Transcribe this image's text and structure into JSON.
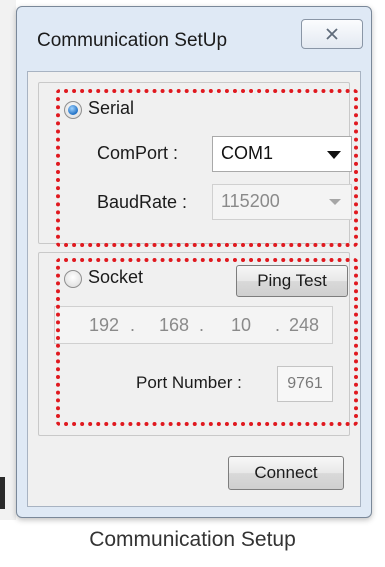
{
  "window": {
    "title": "Communication SetUp",
    "close_glyph": "✕"
  },
  "serial": {
    "radio_label": "Serial",
    "radio_checked": true,
    "comport_label": "ComPort :",
    "comport_value": "COM1",
    "baudrate_label": "BaudRate :",
    "baudrate_value": "115200",
    "baudrate_enabled": false
  },
  "socket": {
    "radio_label": "Socket",
    "radio_checked": false,
    "ping_button_label": "Ping Test",
    "ip_octets": [
      "192",
      "168",
      "10",
      "248"
    ],
    "ip_separator": ".",
    "port_label": "Port Number :",
    "port_value": "9761"
  },
  "actions": {
    "connect_label": "Connect"
  },
  "caption": "Communication Setup",
  "colors": {
    "highlight_border": "#e0191f",
    "window_frame": "#dfe9f5",
    "client_area": "#f0f0f0"
  }
}
